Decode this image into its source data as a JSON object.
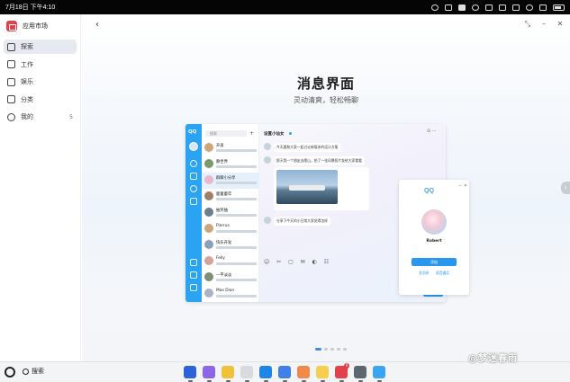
{
  "status_bar": {
    "date_time": "7月18日 下午4:10"
  },
  "sidebar": {
    "app_title": "应用市场",
    "items": [
      {
        "label": "探索",
        "icon": "explore-icon",
        "active": true
      },
      {
        "label": "工作",
        "icon": "work-icon"
      },
      {
        "label": "娱乐",
        "icon": "entertainment-icon"
      },
      {
        "label": "分类",
        "icon": "category-icon"
      },
      {
        "label": "我的",
        "icon": "profile-icon",
        "badge": "5"
      }
    ]
  },
  "hero": {
    "title": "消息界面",
    "subtitle": "灵动清爽，轻松畅聊"
  },
  "preview": {
    "rail_logo": "QQ",
    "search_placeholder": "搜索",
    "plus": "+",
    "chats": [
      {
        "name": "开发"
      },
      {
        "name": "静世界"
      },
      {
        "name": "群聊小分享"
      },
      {
        "name": "鹿童童年"
      },
      {
        "name": "抽奖抽"
      },
      {
        "name": "Pierrus"
      },
      {
        "name": "快乐开发"
      },
      {
        "name": "Felly"
      },
      {
        "name": "一平淡淡"
      },
      {
        "name": "Max Dion"
      }
    ],
    "chat_title": "设置小仙女",
    "messages": [
      "今天要和大家一起讨论新版本的设计方案",
      "那天我一个朋友去爬山，拍了一张风景照片发给大家看看",
      "分享下今天的小日常大家觉得怎样"
    ],
    "tools": "☺ ✂ ▢ ✉ ◐ ☷",
    "profile": {
      "logo": "QQ",
      "name": "Robert",
      "button": "添加",
      "links": "发消息 语音通话"
    }
  },
  "taskbar": {
    "search_label": "搜索",
    "apps": [
      {
        "name": "launcher",
        "color": "#2e62d9"
      },
      {
        "name": "files",
        "color": "#8d66e8"
      },
      {
        "name": "notes",
        "color": "#f0c23a"
      },
      {
        "name": "trash",
        "color": "#d8dade"
      },
      {
        "name": "browser",
        "color": "#1f86e8"
      },
      {
        "name": "mail",
        "color": "#3f7fe6"
      },
      {
        "name": "gallery",
        "color": "#f08a4b"
      },
      {
        "name": "documents",
        "color": "#f6d04d"
      },
      {
        "name": "app-store",
        "color": "#e2404b",
        "badge": "9"
      },
      {
        "name": "settings",
        "color": "#5f6670"
      },
      {
        "name": "assistant",
        "color": "#3ca4f0"
      }
    ]
  },
  "watermark": "@梦迷春雨"
}
